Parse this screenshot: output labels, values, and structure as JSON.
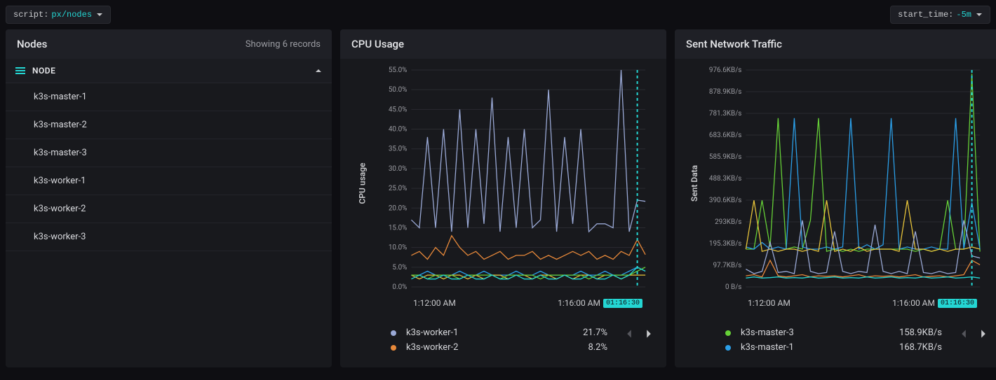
{
  "topbar": {
    "script_label": "script:",
    "script_value": "px/nodes",
    "start_label": "start_time:",
    "start_value": "-5m"
  },
  "nodes_panel": {
    "title": "Nodes",
    "subtitle": "Showing 6 records",
    "group_label": "NODE",
    "items": [
      "k3s-master-1",
      "k3s-master-2",
      "k3s-master-3",
      "k3s-worker-1",
      "k3s-worker-2",
      "k3s-worker-3"
    ]
  },
  "cpu_panel": {
    "title": "CPU Usage",
    "ylabel": "CPU usage",
    "xticks": [
      "1:12:00 AM",
      "1:16:00 AM"
    ],
    "cursor_time": "01:16:30",
    "legend": [
      {
        "name": "k3s-worker-1",
        "value": "21.7%",
        "color": "#9aa9d6"
      },
      {
        "name": "k3s-worker-2",
        "value": "8.2%",
        "color": "#e8893a"
      }
    ]
  },
  "net_panel": {
    "title": "Sent Network Traffic",
    "ylabel": "Sent Data",
    "xticks": [
      "1:12:00 AM",
      "1:16:00 AM"
    ],
    "cursor_time": "01:16:30",
    "legend": [
      {
        "name": "k3s-master-3",
        "value": "158.9KB/s",
        "color": "#66d137"
      },
      {
        "name": "k3s-master-1",
        "value": "168.7KB/s",
        "color": "#2b9fe8"
      }
    ]
  },
  "chart_data": [
    {
      "type": "line",
      "title": "CPU Usage",
      "xlabel": "",
      "ylabel": "CPU usage",
      "ylim": [
        0,
        55
      ],
      "yticks": [
        0,
        5,
        10,
        15,
        20,
        25,
        30,
        35,
        40,
        45,
        50,
        55
      ],
      "ytick_labels": [
        "0.0%",
        "5.0%",
        "10.0%",
        "15.0%",
        "20.0%",
        "25.0%",
        "30.0%",
        "35.0%",
        "40.0%",
        "45.0%",
        "50.0%",
        "55.0%"
      ],
      "x": [
        0,
        1,
        2,
        3,
        4,
        5,
        6,
        7,
        8,
        9,
        10,
        11,
        12,
        13,
        14,
        15,
        16,
        17,
        18,
        19,
        20,
        21,
        22,
        23,
        24,
        25,
        26,
        27,
        28,
        29
      ],
      "xtick_labels_at": {
        "0": "1:12:00 AM",
        "25": "1:16:00 AM"
      },
      "cursor_index": 28,
      "cursor_label": "01:16:30",
      "series": [
        {
          "name": "k3s-worker-1",
          "color": "#9aa9d6",
          "values": [
            17,
            15,
            38,
            15,
            40,
            14,
            45,
            15,
            40,
            16,
            48,
            14,
            38,
            15,
            40,
            15,
            17,
            50,
            14,
            38,
            16,
            40,
            14,
            16,
            16,
            15,
            55,
            14,
            22,
            21.7
          ]
        },
        {
          "name": "k3s-worker-2",
          "color": "#e8893a",
          "values": [
            8,
            9,
            7,
            10,
            8,
            13,
            10,
            8,
            9,
            7,
            8,
            9,
            7,
            8,
            8,
            9,
            7,
            8,
            7,
            8,
            9,
            8,
            9,
            7,
            8,
            7,
            9,
            8,
            12,
            8.2
          ]
        },
        {
          "name": "k3s-master-1",
          "color": "#2b9fe8",
          "values": [
            3,
            3,
            4,
            3,
            3,
            3,
            4,
            3,
            3,
            4,
            3,
            3,
            3,
            4,
            3,
            3,
            4,
            3,
            3,
            3,
            3,
            4,
            3,
            3,
            4,
            3,
            3,
            4,
            5,
            4
          ]
        },
        {
          "name": "k3s-master-2",
          "color": "#e8c53a",
          "values": [
            3,
            2,
            3,
            3,
            2,
            3,
            3,
            2,
            3,
            2,
            3,
            3,
            2,
            3,
            3,
            2,
            3,
            3,
            2,
            3,
            2,
            3,
            3,
            2,
            3,
            3,
            2,
            3,
            3,
            3
          ]
        },
        {
          "name": "k3s-master-3",
          "color": "#66d137",
          "values": [
            3,
            3,
            2,
            3,
            3,
            3,
            2,
            3,
            3,
            3,
            3,
            2,
            3,
            3,
            3,
            3,
            2,
            3,
            3,
            3,
            3,
            3,
            2,
            3,
            3,
            3,
            3,
            3,
            4,
            5
          ]
        },
        {
          "name": "k3s-worker-3",
          "color": "#24d6d3",
          "values": [
            2,
            3,
            2,
            2,
            3,
            2,
            2,
            3,
            2,
            2,
            3,
            2,
            2,
            3,
            2,
            2,
            3,
            2,
            2,
            3,
            2,
            2,
            3,
            2,
            2,
            3,
            2,
            3,
            5,
            4
          ]
        }
      ]
    },
    {
      "type": "line",
      "title": "Sent Network Traffic",
      "xlabel": "",
      "ylabel": "Sent Data",
      "ylim": [
        0,
        976.6
      ],
      "yticks": [
        0,
        97.7,
        195.3,
        293,
        390.6,
        488.3,
        585.9,
        683.6,
        781.3,
        878.9,
        976.6
      ],
      "ytick_labels": [
        "0 B/s",
        "97.7KB/s",
        "195.3KB/s",
        "293KB/s",
        "390.6KB/s",
        "488.3KB/s",
        "585.9KB/s",
        "683.6KB/s",
        "781.3KB/s",
        "878.9KB/s",
        "976.6KB/s"
      ],
      "x": [
        0,
        1,
        2,
        3,
        4,
        5,
        6,
        7,
        8,
        9,
        10,
        11,
        12,
        13,
        14,
        15,
        16,
        17,
        18,
        19,
        20,
        21,
        22,
        23,
        24,
        25,
        26,
        27,
        28,
        29
      ],
      "xtick_labels_at": {
        "0": "1:12:00 AM",
        "25": "1:16:00 AM"
      },
      "cursor_index": 28,
      "cursor_label": "01:16:30",
      "series": [
        {
          "name": "k3s-master-3",
          "color": "#66d137",
          "values": [
            170,
            170,
            390,
            180,
            760,
            170,
            180,
            170,
            300,
            760,
            160,
            170,
            160,
            170,
            160,
            170,
            170,
            170,
            170,
            170,
            170,
            160,
            170,
            160,
            170,
            390,
            170,
            170,
            960,
            158.9
          ]
        },
        {
          "name": "k3s-master-1",
          "color": "#2b9fe8",
          "values": [
            180,
            170,
            200,
            170,
            180,
            170,
            760,
            180,
            170,
            170,
            180,
            170,
            180,
            760,
            170,
            190,
            170,
            190,
            760,
            170,
            180,
            170,
            170,
            180,
            170,
            170,
            760,
            170,
            380,
            168.7
          ]
        },
        {
          "name": "k3s-master-2",
          "color": "#e8c53a",
          "values": [
            170,
            390,
            160,
            170,
            160,
            170,
            170,
            160,
            170,
            160,
            390,
            160,
            170,
            160,
            180,
            160,
            170,
            170,
            170,
            160,
            390,
            170,
            170,
            160,
            170,
            160,
            170,
            170,
            180,
            170
          ]
        },
        {
          "name": "k3s-worker-1",
          "color": "#9aa9d6",
          "values": [
            80,
            60,
            70,
            200,
            65,
            70,
            60,
            300,
            70,
            60,
            65,
            250,
            70,
            60,
            70,
            65,
            280,
            70,
            60,
            70,
            60,
            250,
            65,
            60,
            70,
            60,
            65,
            300,
            140,
            130
          ]
        },
        {
          "name": "k3s-worker-2",
          "color": "#e8893a",
          "values": [
            50,
            55,
            45,
            120,
            50,
            45,
            50,
            55,
            45,
            50,
            48,
            50,
            45,
            50,
            55,
            45,
            50,
            48,
            50,
            45,
            50,
            55,
            45,
            48,
            50,
            45,
            50,
            55,
            120,
            100
          ]
        },
        {
          "name": "k3s-worker-3",
          "color": "#24d6d3",
          "values": [
            40,
            45,
            40,
            42,
            45,
            40,
            42,
            40,
            45,
            40,
            42,
            45,
            40,
            42,
            40,
            45,
            40,
            42,
            45,
            40,
            42,
            40,
            45,
            40,
            42,
            45,
            40,
            42,
            45,
            40
          ]
        }
      ]
    }
  ]
}
